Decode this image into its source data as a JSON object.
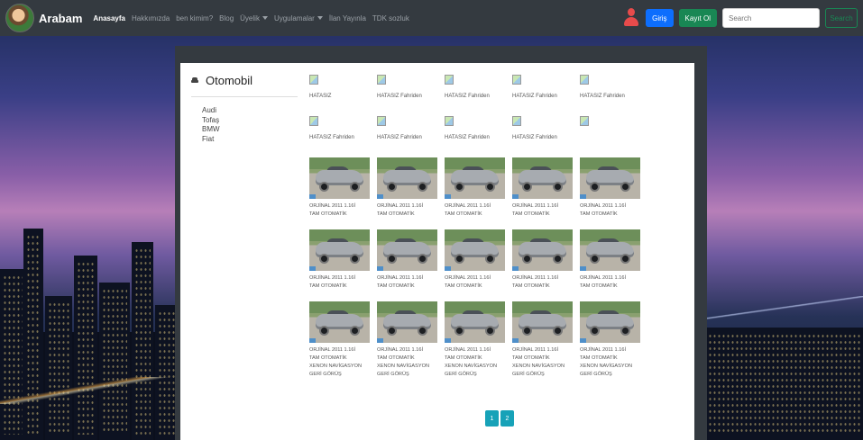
{
  "navbar": {
    "brand": "Arabam",
    "links": [
      {
        "label": "Anasayfa",
        "active": true
      },
      {
        "label": "Hakkımızda"
      },
      {
        "label": "ben kimim?"
      },
      {
        "label": "Blog"
      },
      {
        "label": "Üyelik",
        "dropdown": true
      },
      {
        "label": "Uygulamalar",
        "dropdown": true
      },
      {
        "label": "İlan Yayınla"
      },
      {
        "label": "TDK sozluk"
      }
    ],
    "login_label": "Giriş",
    "register_label": "Kayıt Ol",
    "search_placeholder": "Search",
    "search_button": "Search"
  },
  "sidebar": {
    "title": "Otomobil",
    "brands": [
      "Audi",
      "Tofaş",
      "BMW",
      "Fiat"
    ]
  },
  "broken_items": [
    [
      "HATASIZ",
      "HATASIZ Fahriden",
      "HATASIZ Fahriden",
      "HATASIZ Fahriden",
      "HATASIZ Fahriden"
    ],
    [
      "HATASIZ Fahriden",
      "HATASIZ Fahriden",
      "HATASIZ Fahriden",
      "HATASIZ Fahriden",
      ""
    ]
  ],
  "car_captions": {
    "line1": "ORJİNAL 2011 1.16İ",
    "line2": "TAM OTOMATİK",
    "line3": "XENON NAVİGASYON",
    "line4": "GERİ GÖRÜŞ"
  },
  "pagination": [
    "1",
    "2"
  ],
  "colors": {
    "navbar": "#343a40",
    "primary": "#0d6efd",
    "success": "#198754",
    "pagination": "#17a2b8",
    "user_icon": "#e84b4b"
  }
}
